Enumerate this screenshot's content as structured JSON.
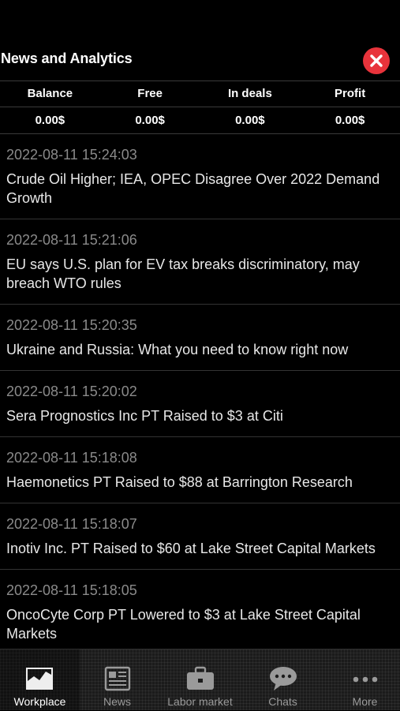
{
  "header": {
    "title": "News and Analytics"
  },
  "stats": {
    "headers": [
      "Balance",
      "Free",
      "In deals",
      "Profit"
    ],
    "values": [
      "0.00$",
      "0.00$",
      "0.00$",
      "0.00$"
    ]
  },
  "news": [
    {
      "time": "2022-08-11 15:24:03",
      "headline": "Crude Oil Higher; IEA, OPEC Disagree Over 2022 Demand Growth"
    },
    {
      "time": "2022-08-11 15:21:06",
      "headline": "EU says U.S. plan for EV tax breaks discriminatory, may breach WTO rules"
    },
    {
      "time": "2022-08-11 15:20:35",
      "headline": "Ukraine and Russia: What you need to know right now"
    },
    {
      "time": "2022-08-11 15:20:02",
      "headline": "Sera Prognostics Inc PT Raised to $3 at Citi"
    },
    {
      "time": "2022-08-11 15:18:08",
      "headline": "Haemonetics PT Raised to $88 at Barrington Research"
    },
    {
      "time": "2022-08-11 15:18:07",
      "headline": "Inotiv Inc. PT Raised to $60 at Lake Street Capital Markets"
    },
    {
      "time": "2022-08-11 15:18:05",
      "headline": "OncoCyte Corp PT Lowered to $3 at Lake Street Capital Markets"
    }
  ],
  "tabbar": {
    "tabs": [
      {
        "label": "Workplace",
        "icon": "chart-icon",
        "active": true
      },
      {
        "label": "News",
        "icon": "newspaper-icon",
        "active": false
      },
      {
        "label": "Labor market",
        "icon": "briefcase-icon",
        "active": false
      },
      {
        "label": "Chats",
        "icon": "chat-bubble-icon",
        "active": false
      },
      {
        "label": "More",
        "icon": "more-dots-icon",
        "active": false
      }
    ]
  },
  "colors": {
    "background": "#000000",
    "close_button": "#e8333b",
    "timestamp": "#8a8a8a",
    "tab_inactive": "#9a9a9a"
  }
}
